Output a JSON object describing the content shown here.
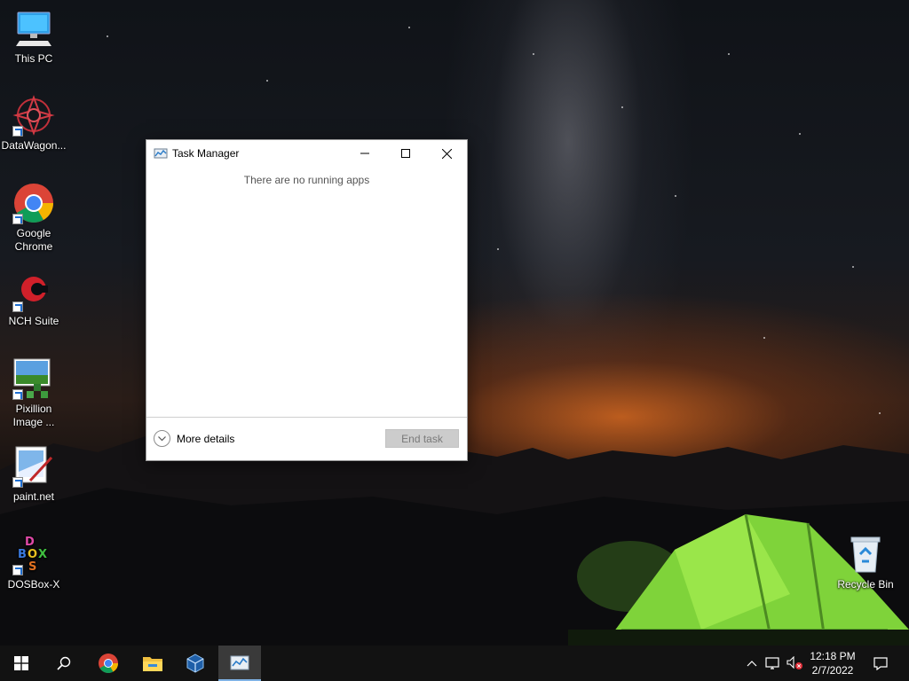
{
  "desktop": {
    "icons": [
      {
        "label": "This PC"
      },
      {
        "label": "DataWagon..."
      },
      {
        "label": "Google Chrome"
      },
      {
        "label": "NCH Suite"
      },
      {
        "label": "Pixillion Image ..."
      },
      {
        "label": "paint.net"
      },
      {
        "label": "DOSBox-X"
      },
      {
        "label": "Recycle Bin"
      }
    ]
  },
  "task_manager": {
    "title": "Task Manager",
    "empty_message": "There are no running apps",
    "more_details_label": "More details",
    "end_task_label": "End task"
  },
  "taskbar": {
    "items": [
      {
        "icon": "windows-start-icon"
      },
      {
        "icon": "search-icon"
      },
      {
        "icon": "chrome-icon"
      },
      {
        "icon": "file-explorer-icon"
      },
      {
        "icon": "virtualbox-icon"
      },
      {
        "icon": "task-manager-icon",
        "active": true
      }
    ],
    "tray": {
      "icons": [
        "chevron-up-icon",
        "network-icon",
        "volume-muted-icon",
        "notifications-icon"
      ],
      "time": "12:18 PM",
      "date": "2/7/2022"
    }
  },
  "colors": {
    "taskbar": "#121212",
    "accent": "#7fb2e5",
    "window_bg": "#ffffff",
    "disabled_button": "#cccccc"
  }
}
